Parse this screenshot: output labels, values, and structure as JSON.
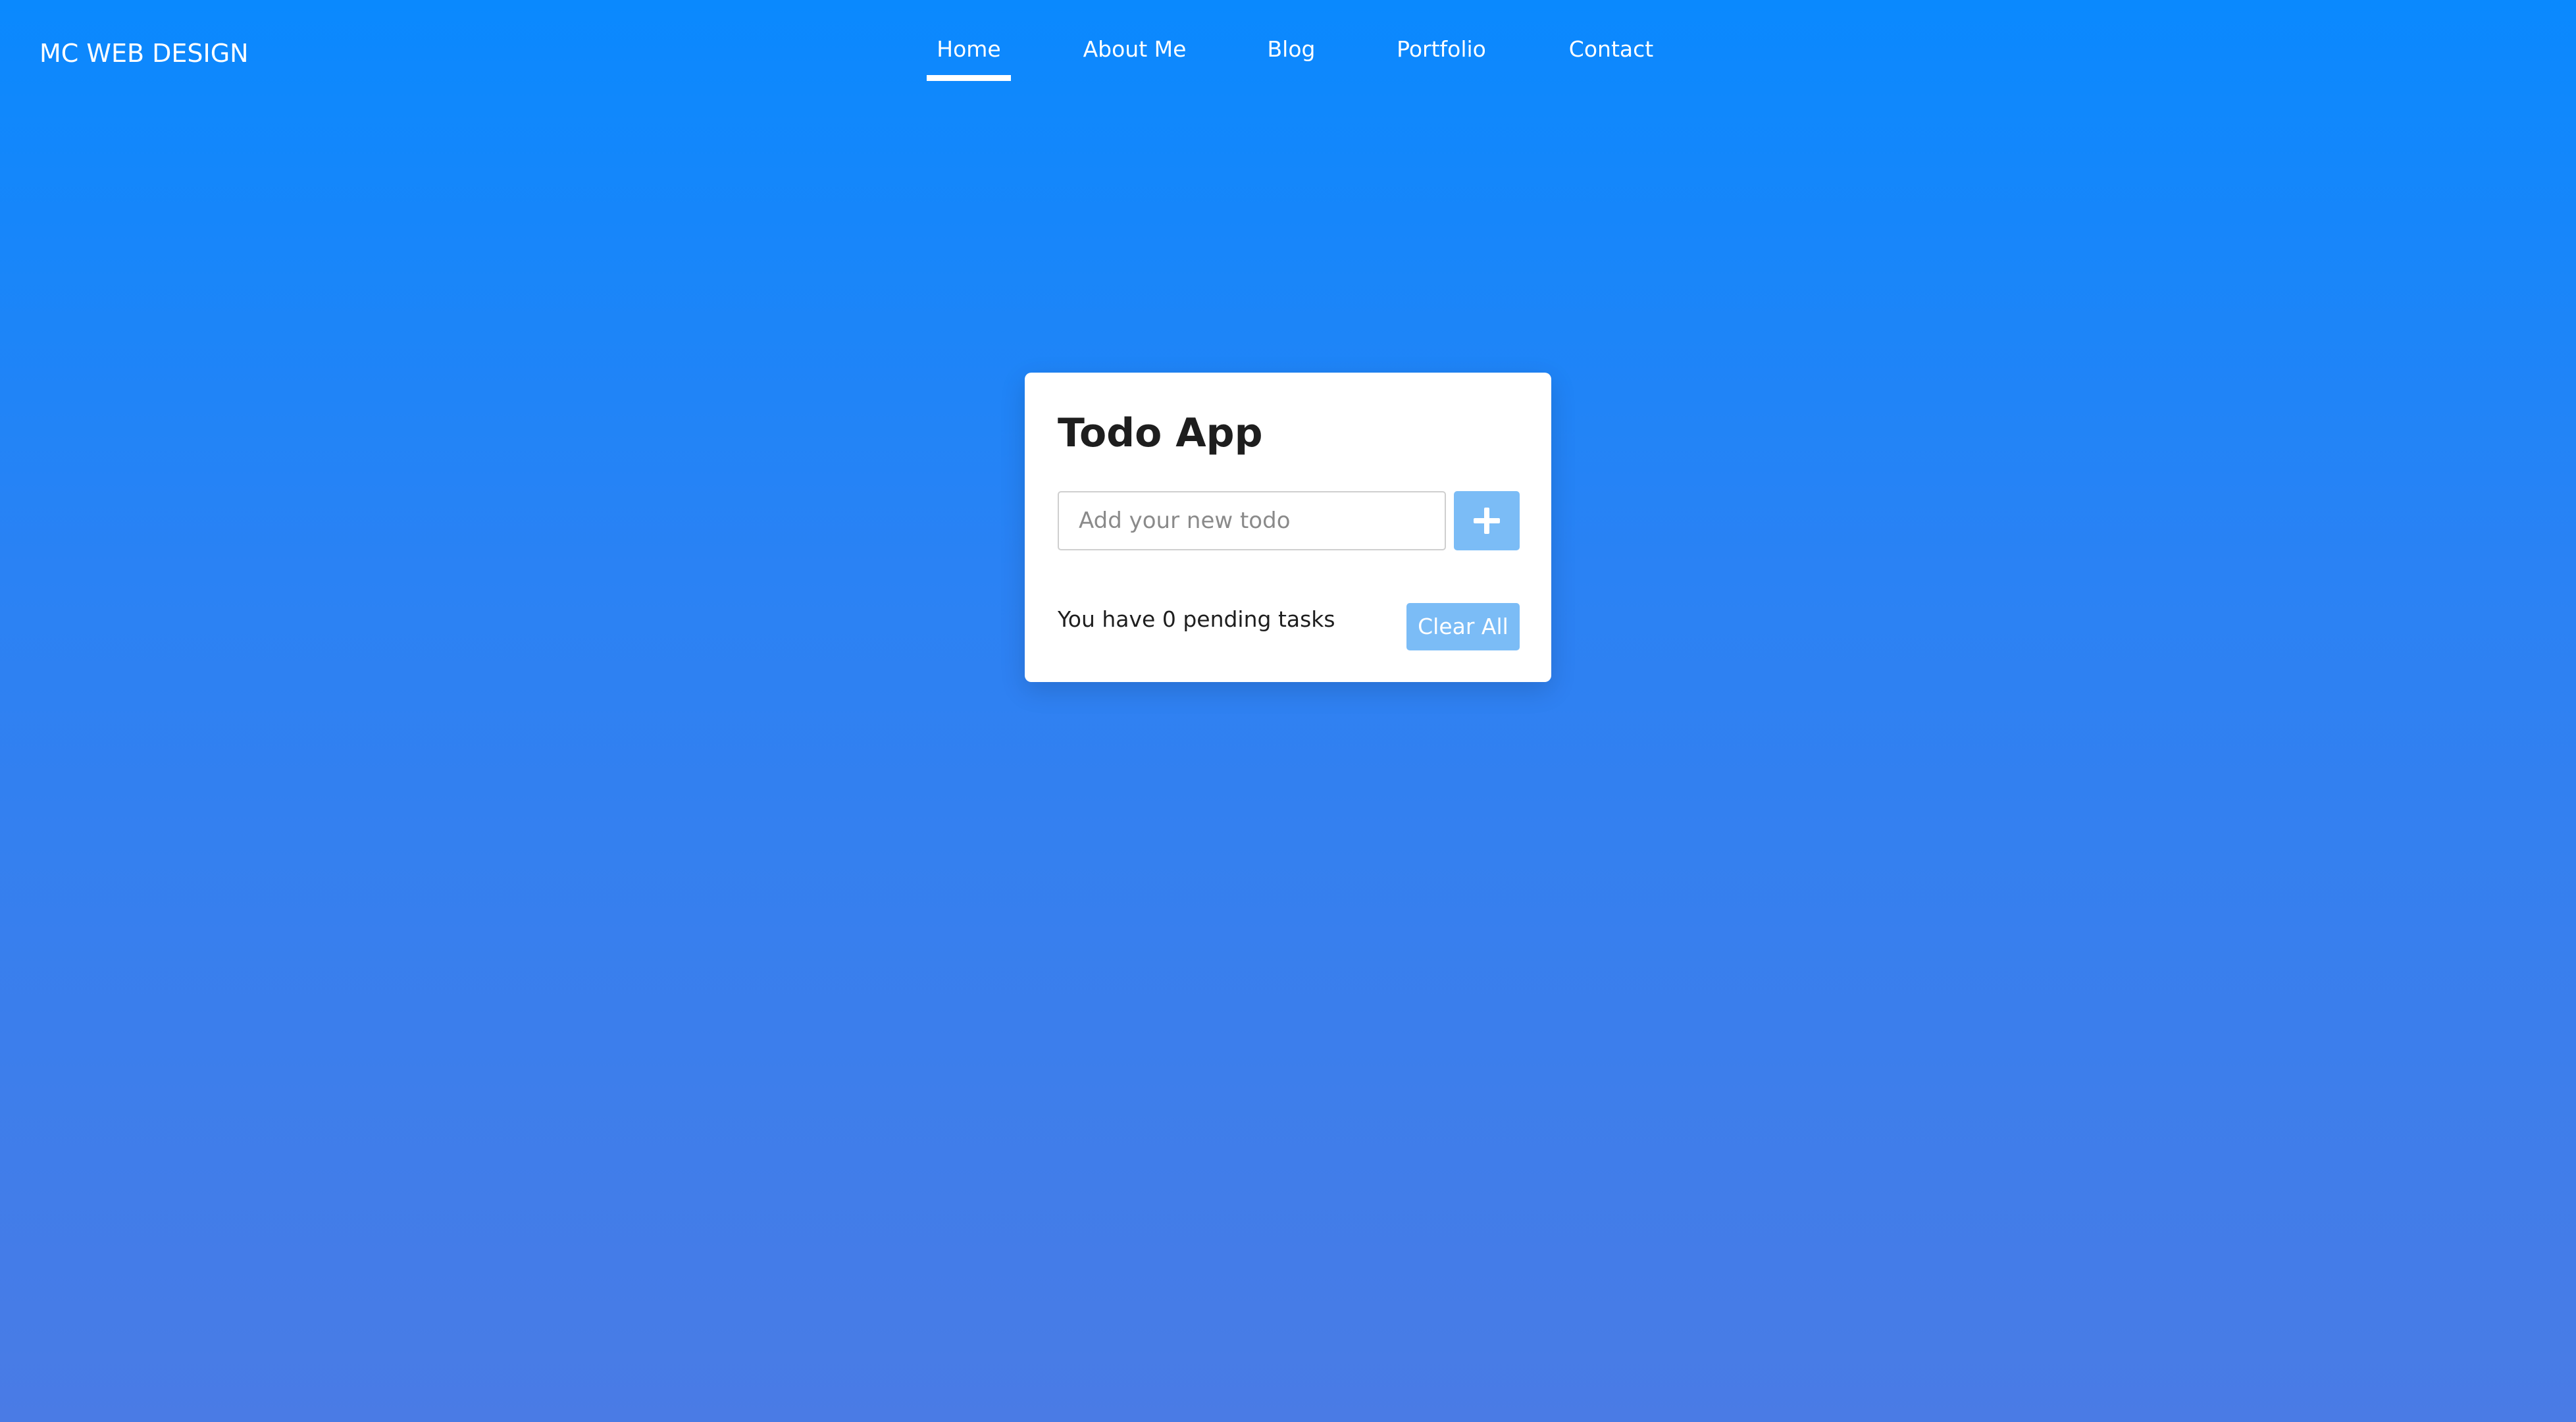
{
  "header": {
    "logo_text": "MC WEB DESIGN"
  },
  "nav": {
    "items": [
      {
        "label": "Home",
        "active": true
      },
      {
        "label": "About Me",
        "active": false
      },
      {
        "label": "Blog",
        "active": false
      },
      {
        "label": "Portfolio",
        "active": false
      },
      {
        "label": "Contact",
        "active": false
      }
    ]
  },
  "todo": {
    "title": "Todo App",
    "input_value": "",
    "input_placeholder": "Add your new todo",
    "add_button_icon": "plus-icon",
    "pending_text": "You have 0 pending tasks",
    "clear_button_label": "Clear All"
  },
  "colors": {
    "background_top": "#0a89fe",
    "background_bottom": "#4a7be5",
    "card_background": "#ffffff",
    "button_background": "#7bbcf6",
    "title_text": "#1e1e1e"
  }
}
